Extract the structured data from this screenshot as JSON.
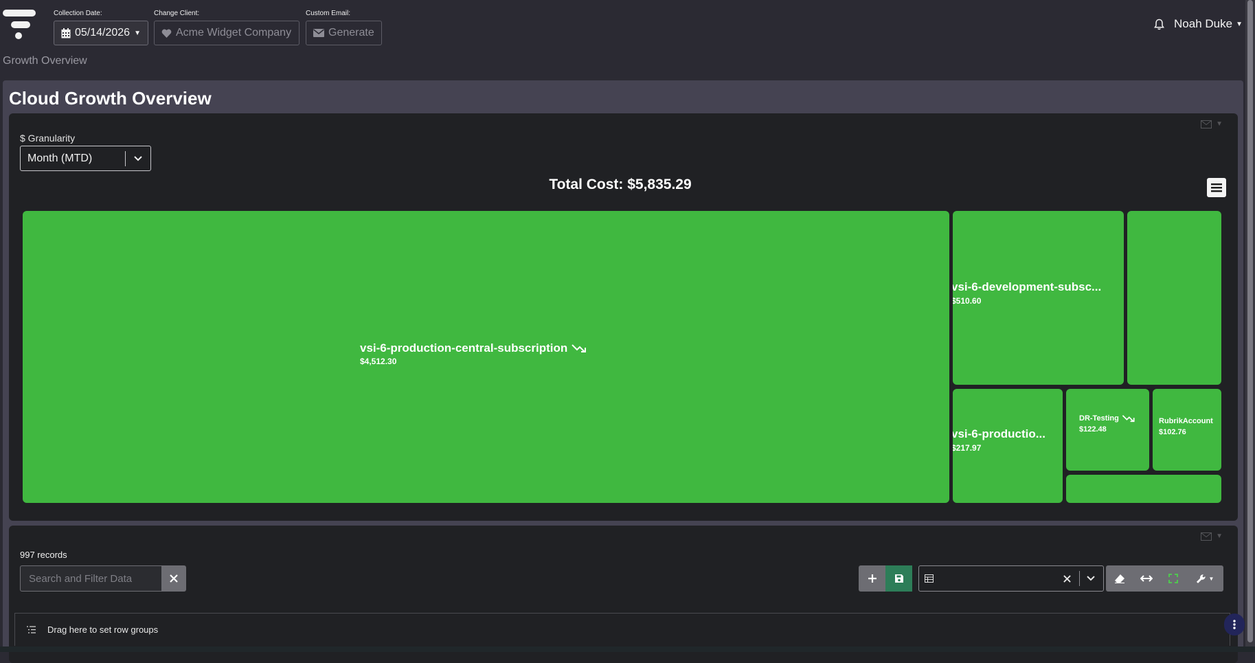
{
  "header": {
    "collection_date_label": "Collection Date:",
    "collection_date_value": "05/14/2026",
    "change_client_label": "Change Client:",
    "client_value": "Acme Widget Company",
    "custom_email_label": "Custom Email:",
    "generate_label": "Generate",
    "user_name": "Noah Duke"
  },
  "breadcrumb": "Growth Overview",
  "page_title": "Cloud Growth Overview",
  "granularity": {
    "label": "$ Granularity",
    "value": "Month (MTD)"
  },
  "total_cost": "Total Cost: $5,835.29",
  "treemap": {
    "tiles": [
      {
        "name": "vsi-6-production-central-subscription",
        "value": "$4,512.30",
        "trend": "down"
      },
      {
        "name": "vsi-6-development-subsc...",
        "value": "$510.60"
      },
      {
        "name": "vsi-6-productio...",
        "value": "$217.97"
      },
      {
        "name": "DR-Testing",
        "value": "$122.48",
        "trend": "down"
      },
      {
        "name": "RubrikAccount",
        "value": "$102.76"
      }
    ],
    "color": "#40b840"
  },
  "grid": {
    "records": "997 records",
    "search_placeholder": "Search and Filter Data",
    "row_groups_hint": "Drag here to set row groups"
  }
}
